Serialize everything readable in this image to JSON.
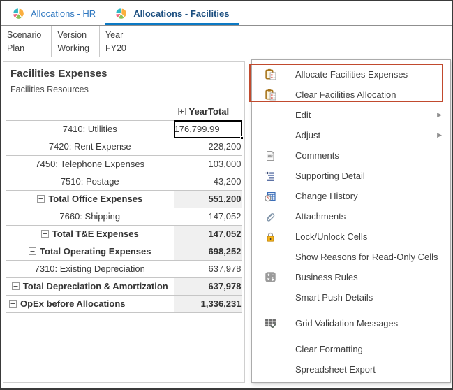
{
  "tabs": [
    {
      "label": "Allocations - HR",
      "active": false
    },
    {
      "label": "Allocations - Facilities",
      "active": true
    }
  ],
  "pov": [
    {
      "dimension": "Scenario",
      "member": "Plan"
    },
    {
      "dimension": "Version",
      "member": "Working"
    },
    {
      "dimension": "Year",
      "member": "FY20"
    }
  ],
  "grid": {
    "title": "Facilities Expenses",
    "subtitle": "Facilities Resources",
    "column_header": "YearTotal",
    "rows": [
      {
        "label": "7410: Utilities",
        "value": "176,799.99",
        "total": false,
        "collapse": false,
        "selected": true
      },
      {
        "label": "7420: Rent Expense",
        "value": "228,200",
        "total": false,
        "collapse": false
      },
      {
        "label": "7450: Telephone Expenses",
        "value": "103,000",
        "total": false,
        "collapse": false
      },
      {
        "label": "7510: Postage",
        "value": "43,200",
        "total": false,
        "collapse": false
      },
      {
        "label": "Total Office Expenses",
        "value": "551,200",
        "total": true,
        "collapse": true
      },
      {
        "label": "7660: Shipping",
        "value": "147,052",
        "total": false,
        "collapse": false
      },
      {
        "label": "Total T&E Expenses",
        "value": "147,052",
        "total": true,
        "collapse": true
      },
      {
        "label": "Total Operating Expenses",
        "value": "698,252",
        "total": true,
        "collapse": true
      },
      {
        "label": "7310: Existing Depreciation",
        "value": "637,978",
        "total": false,
        "collapse": false
      },
      {
        "label": "Total Depreciation & Amortization",
        "value": "637,978",
        "total": true,
        "collapse": true
      },
      {
        "label": "OpEx before Allocations",
        "value": "1,336,231",
        "total": true,
        "collapse": true,
        "label_align": "left"
      }
    ]
  },
  "context_menu": {
    "items": [
      {
        "label": "Allocate Facilities Expenses",
        "icon": "rule-clipboard-icon",
        "highlighted": true
      },
      {
        "label": "Clear Facilities Allocation",
        "icon": "rule-clipboard-icon",
        "highlighted": true
      },
      {
        "label": "Edit",
        "submenu": true
      },
      {
        "label": "Adjust",
        "submenu": true
      },
      {
        "label": "Comments",
        "icon": "comments-icon"
      },
      {
        "label": "Supporting Detail",
        "icon": "supporting-detail-icon"
      },
      {
        "label": "Change History",
        "icon": "change-history-icon"
      },
      {
        "label": "Attachments",
        "icon": "attachments-icon"
      },
      {
        "label": "Lock/Unlock Cells",
        "icon": "lock-icon"
      },
      {
        "label": "Show Reasons for Read-Only Cells"
      },
      {
        "label": "Business Rules",
        "icon": "business-rules-icon"
      },
      {
        "label": "Smart Push Details"
      },
      {
        "label": "Grid Validation Messages",
        "icon": "grid-validation-icon",
        "section_break": true
      },
      {
        "label": "Clear Formatting",
        "section_break": true
      },
      {
        "label": "Spreadsheet Export"
      }
    ]
  },
  "colors": {
    "accent_blue": "#0b79c4",
    "tab_inactive_blue": "#2e77c0",
    "tab_active_navy": "#1c4f80",
    "annotation_red": "#c14a2e",
    "total_row_bg": "#f0f0f0",
    "selected_cell_border": "#000000"
  }
}
